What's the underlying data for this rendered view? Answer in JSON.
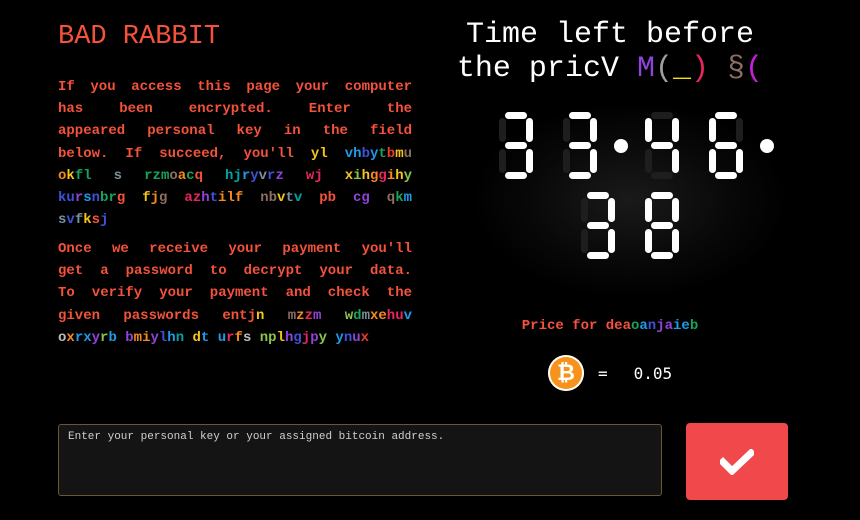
{
  "colors": {
    "accent_red": "#f4523b",
    "button_red": "#f0484b",
    "bitcoin_orange": "#f7931a",
    "input_border": "#6b5533"
  },
  "header": {
    "title": "BAD RABBIT"
  },
  "message": {
    "para1_lines": [
      [
        {
          "t": "If you access this page your computer",
          "c": "#f4523b"
        }
      ],
      [
        {
          "t": "has been encrypted. Enter the",
          "c": "#f4523b"
        }
      ],
      [
        {
          "t": "appeared personal key in the field",
          "c": "#f4523b"
        }
      ],
      [
        {
          "t": "below. If succeed, you'll ",
          "c": "#f4523b"
        },
        {
          "t": "yl",
          "c": "#f5c518"
        },
        {
          "t": " ",
          "c": "#f4523b"
        },
        {
          "t": "v",
          "c": "#1e9be8"
        },
        {
          "t": "h",
          "c": "#1e9be8"
        },
        {
          "t": "b",
          "c": "#3f51d8"
        },
        {
          "t": "y",
          "c": "#1e9be8"
        },
        {
          "t": "t",
          "c": "#19a35a"
        },
        {
          "t": "b",
          "c": "#e63b2e"
        },
        {
          "t": "m",
          "c": "#f5c518"
        },
        {
          "t": "u",
          "c": "#8d6e63"
        }
      ],
      [
        {
          "t": "o",
          "c": "#f58a1f"
        },
        {
          "t": "k",
          "c": "#f5c518"
        },
        {
          "t": "f",
          "c": "#19a35a"
        },
        {
          "t": "l",
          "c": "#19a35a"
        },
        {
          "t": " ",
          "c": "#f4523b"
        },
        {
          "t": "s",
          "c": "#78909c"
        },
        {
          "t": " ",
          "c": "#f4523b"
        },
        {
          "t": "r",
          "c": "#19a35a"
        },
        {
          "t": "z",
          "c": "#19a35a"
        },
        {
          "t": "m",
          "c": "#19a35a"
        },
        {
          "t": "o",
          "c": "#8d6e63"
        },
        {
          "t": "a",
          "c": "#f58a1f"
        },
        {
          "t": "c",
          "c": "#19a35a"
        },
        {
          "t": "q",
          "c": "#f4523b"
        },
        {
          "t": " ",
          "c": "#f4523b"
        },
        {
          "t": "h",
          "c": "#00a3a3"
        },
        {
          "t": "j",
          "c": "#00a3a3"
        },
        {
          "t": "r",
          "c": "#1e9be8"
        },
        {
          "t": "y",
          "c": "#3f51d8"
        },
        {
          "t": "v",
          "c": "#78909c"
        },
        {
          "t": "r",
          "c": "#3f51d8"
        },
        {
          "t": "z",
          "c": "#8e44d8"
        },
        {
          "t": " ",
          "c": "#f4523b"
        },
        {
          "t": "w",
          "c": "#e8265e"
        },
        {
          "t": "j",
          "c": "#e8265e"
        },
        {
          "t": " ",
          "c": "#f4523b"
        },
        {
          "t": "x",
          "c": "#f5c518"
        },
        {
          "t": "i",
          "c": "#8bc34a"
        },
        {
          "t": "h",
          "c": "#f5c518"
        },
        {
          "t": "g",
          "c": "#f58a1f"
        },
        {
          "t": "g",
          "c": "#e8265e"
        },
        {
          "t": "i",
          "c": "#f58a1f"
        },
        {
          "t": "h",
          "c": "#f5c518"
        },
        {
          "t": "y",
          "c": "#8bc34a"
        }
      ],
      [
        {
          "t": "k",
          "c": "#3f51d8"
        },
        {
          "t": "u",
          "c": "#3f51d8"
        },
        {
          "t": "r",
          "c": "#8e44d8"
        },
        {
          "t": "s",
          "c": "#1e9be8"
        },
        {
          "t": "n",
          "c": "#3f51d8"
        },
        {
          "t": "b",
          "c": "#19a35a"
        },
        {
          "t": "r",
          "c": "#19a35a"
        },
        {
          "t": "g",
          "c": "#f4523b"
        },
        {
          "t": " ",
          "c": "#f4523b"
        },
        {
          "t": "f",
          "c": "#f5c518"
        },
        {
          "t": "j",
          "c": "#f58a1f"
        },
        {
          "t": "g",
          "c": "#8d6e63"
        },
        {
          "t": " ",
          "c": "#f4523b"
        },
        {
          "t": "a",
          "c": "#e8265e"
        },
        {
          "t": "z",
          "c": "#e8265e"
        },
        {
          "t": "h",
          "c": "#8e44d8"
        },
        {
          "t": "t",
          "c": "#3f51d8"
        },
        {
          "t": "i",
          "c": "#f58a1f"
        },
        {
          "t": "l",
          "c": "#f58a1f"
        },
        {
          "t": "f",
          "c": "#f58a1f"
        },
        {
          "t": " ",
          "c": "#f4523b"
        },
        {
          "t": "n",
          "c": "#8d6e63"
        },
        {
          "t": "b",
          "c": "#8d6e63"
        },
        {
          "t": "v",
          "c": "#f5c518"
        },
        {
          "t": "t",
          "c": "#78909c"
        },
        {
          "t": "v",
          "c": "#00a3a3"
        },
        {
          "t": " ",
          "c": "#f4523b"
        },
        {
          "t": "pb",
          "c": "#f4523b"
        },
        {
          "t": " ",
          "c": "#f4523b"
        },
        {
          "t": "cg",
          "c": "#8e44d8"
        },
        {
          "t": " ",
          "c": "#f4523b"
        },
        {
          "t": "q",
          "c": "#8d6e63"
        },
        {
          "t": "k",
          "c": "#19a35a"
        },
        {
          "t": "m",
          "c": "#1e9be8"
        }
      ],
      [
        {
          "t": "s",
          "c": "#78909c"
        },
        {
          "t": "v",
          "c": "#3f51d8"
        },
        {
          "t": "f",
          "c": "#78909c"
        },
        {
          "t": "k",
          "c": "#f5c518"
        },
        {
          "t": "s",
          "c": "#f4523b"
        },
        {
          "t": "j",
          "c": "#3f51d8"
        }
      ]
    ],
    "para2_lines": [
      [
        {
          "t": "Once we receive your payment you'll",
          "c": "#f4523b"
        }
      ],
      [
        {
          "t": "get a password to decrypt your data.",
          "c": "#f4523b"
        }
      ],
      [
        {
          "t": "To verify your payment and check the",
          "c": "#f4523b"
        }
      ],
      [
        {
          "t": "given passwords ent",
          "c": "#f4523b"
        },
        {
          "t": "j",
          "c": "#f4523b"
        },
        {
          "t": "n",
          "c": "#f5c518"
        },
        {
          "t": " ",
          "c": "#f4523b"
        },
        {
          "t": "m",
          "c": "#8d6e63"
        },
        {
          "t": "z",
          "c": "#f58a1f"
        },
        {
          "t": "z",
          "c": "#e8265e"
        },
        {
          "t": "m",
          "c": "#8e44d8"
        },
        {
          "t": " ",
          "c": "#f4523b"
        },
        {
          "t": "w",
          "c": "#8bc34a"
        },
        {
          "t": "d",
          "c": "#19a35a"
        },
        {
          "t": "m",
          "c": "#78909c"
        },
        {
          "t": "x",
          "c": "#f58a1f"
        },
        {
          "t": "e",
          "c": "#f58a1f"
        },
        {
          "t": "h",
          "c": "#e8265e"
        },
        {
          "t": "u",
          "c": "#e8265e"
        },
        {
          "t": "v",
          "c": "#1e9be8"
        }
      ],
      [
        {
          "t": "o",
          "c": "#bdbdbd"
        },
        {
          "t": "x",
          "c": "#f58a1f"
        },
        {
          "t": "r",
          "c": "#1e9be8"
        },
        {
          "t": "x",
          "c": "#1e9be8"
        },
        {
          "t": "y",
          "c": "#8e44d8"
        },
        {
          "t": "r",
          "c": "#8bc34a"
        },
        {
          "t": "b",
          "c": "#1e9be8"
        },
        {
          "t": " ",
          "c": "#f4523b"
        },
        {
          "t": "b",
          "c": "#8e44d8"
        },
        {
          "t": "m",
          "c": "#f58a1f"
        },
        {
          "t": "i",
          "c": "#f58a1f"
        },
        {
          "t": "y",
          "c": "#8e44d8"
        },
        {
          "t": "l",
          "c": "#3f51d8"
        },
        {
          "t": "h",
          "c": "#1e9be8"
        },
        {
          "t": "n",
          "c": "#00a3a3"
        },
        {
          "t": " ",
          "c": "#f4523b"
        },
        {
          "t": "d",
          "c": "#f5c518"
        },
        {
          "t": "t",
          "c": "#1e9be8"
        },
        {
          "t": " ",
          "c": "#f4523b"
        },
        {
          "t": "u",
          "c": "#1e9be8"
        },
        {
          "t": "r",
          "c": "#e8265e"
        },
        {
          "t": "f",
          "c": "#f58a1f"
        },
        {
          "t": "s",
          "c": "#bdbdbd"
        },
        {
          "t": " ",
          "c": "#f4523b"
        },
        {
          "t": "n",
          "c": "#8bc34a"
        },
        {
          "t": "p",
          "c": "#8bc34a"
        },
        {
          "t": "l",
          "c": "#f5c518"
        },
        {
          "t": "h",
          "c": "#8e44d8"
        },
        {
          "t": "g",
          "c": "#3f51d8"
        },
        {
          "t": "j",
          "c": "#e8265e"
        },
        {
          "t": "p",
          "c": "#8e44d8"
        },
        {
          "t": "y",
          "c": "#8bc34a"
        },
        {
          "t": " ",
          "c": "#f4523b"
        },
        {
          "t": "y",
          "c": "#1e9be8"
        },
        {
          "t": "n",
          "c": "#3f51d8"
        },
        {
          "t": "u",
          "c": "#8e44d8"
        },
        {
          "t": "x",
          "c": "#e63b2e"
        }
      ]
    ]
  },
  "timer": {
    "title_line1": [
      {
        "t": "Time left before",
        "c": "#ffffff"
      }
    ],
    "title_line2": [
      {
        "t": "the pricV ",
        "c": "#ffffff"
      },
      {
        "t": "M",
        "c": "#8e44d8"
      },
      {
        "t": "(",
        "c": "#9e9e9e"
      },
      {
        "t": "_",
        "c": "#f5e10b"
      },
      {
        "t": ")",
        "c": "#e8265e"
      },
      {
        "t": " ",
        "c": "#ffffff"
      },
      {
        "t": "§",
        "c": "#8d6e63"
      },
      {
        "t": "(",
        "c": "#c51fd8"
      }
    ],
    "hours": "33",
    "minutes": "46",
    "seconds": "38",
    "display": "33:46:38"
  },
  "price": {
    "label": [
      {
        "t": "Price for dea",
        "c": "#f4523b"
      },
      {
        "t": "o",
        "c": "#19a35a"
      },
      {
        "t": "a",
        "c": "#1e9be8"
      },
      {
        "t": "n",
        "c": "#3f51d8"
      },
      {
        "t": "j",
        "c": "#8e44d8"
      },
      {
        "t": "a",
        "c": "#8e44d8"
      },
      {
        "t": "i",
        "c": "#1e9be8"
      },
      {
        "t": "e",
        "c": "#1e9be8"
      },
      {
        "t": "b",
        "c": "#19a35a"
      }
    ],
    "currency_icon": "bitcoin-icon",
    "currency_symbol": "₿",
    "equals": "=",
    "amount": "0.05"
  },
  "form": {
    "key_placeholder": "Enter your personal key or your assigned bitcoin address.",
    "key_value": "",
    "submit_icon": "checkmark-icon"
  }
}
